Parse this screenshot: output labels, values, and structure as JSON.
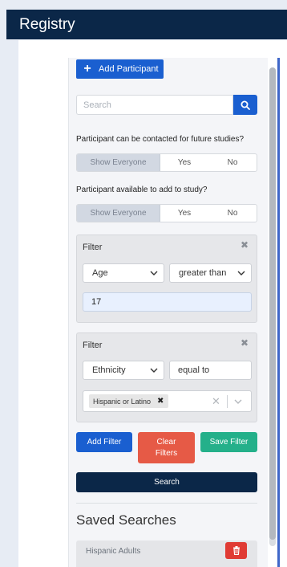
{
  "header": {
    "title": "Registry"
  },
  "toolbar": {
    "add_participant_label": "Add Participant"
  },
  "search": {
    "placeholder": "Search"
  },
  "contact_question": {
    "label": "Participant can be contacted for future studies?",
    "options": [
      "Show Everyone",
      "Yes",
      "No"
    ],
    "selected": "Show Everyone"
  },
  "available_question": {
    "label": "Participant available to add to study?",
    "options": [
      "Show Everyone",
      "Yes",
      "No"
    ],
    "selected": "Show Everyone"
  },
  "filters": [
    {
      "title": "Filter",
      "field": "Age",
      "operator": "greater than",
      "value": "17"
    },
    {
      "title": "Filter",
      "field": "Ethnicity",
      "operator": "equal to",
      "values": [
        "Hispanic or Latino"
      ]
    }
  ],
  "actions": {
    "add_filter": "Add Filter",
    "clear_filters": "Clear Filters",
    "save_filter": "Save Filter",
    "search": "Search"
  },
  "saved_searches": {
    "title": "Saved Searches",
    "items": [
      {
        "name": "Hispanic Adults"
      }
    ]
  },
  "colors": {
    "header": "#0b2748",
    "primary": "#1a5fd0",
    "danger": "#e65a46",
    "success": "#24b08a"
  }
}
